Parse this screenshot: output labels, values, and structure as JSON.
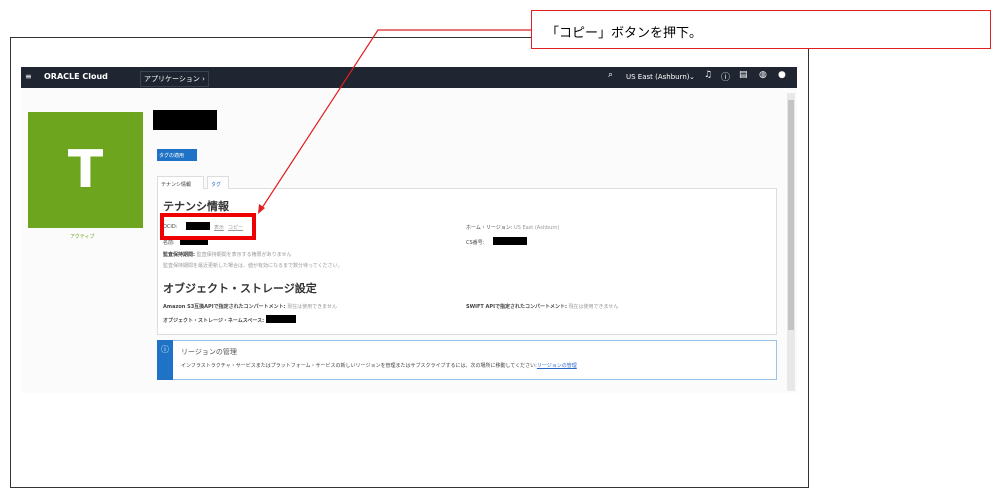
{
  "callout": "「コピー」ボタンを押下。",
  "nav": {
    "brand": "ORACLE Cloud",
    "apps": "アプリケーション ›",
    "region": "US East (Ashburn)",
    "icons": [
      "menu-icon",
      "search-icon",
      "chevron-down-icon",
      "bell-icon",
      "help-icon",
      "chat-icon",
      "globe-icon",
      "profile-icon"
    ]
  },
  "tenancy": {
    "initial": "T",
    "status": "アクティブ",
    "tag_button": "タグの適用"
  },
  "tabs": [
    "テナンシ情報",
    "タグ"
  ],
  "info": {
    "heading": "テナンシ情報",
    "ocid_label": "OCID:",
    "show": "表示",
    "copy": "コピー",
    "name_label": "名前:",
    "home_region_label": "ホーム・リージョン:",
    "home_region": "US East (Ashburn)",
    "cs_label": "CS番号:",
    "audit_label": "監査保持期間:",
    "audit_value": "監査保持期間を表示する権限がありません",
    "audit_note": "監査保持期間を最近更新した場合は、値が有効になるまで数分待ってください。"
  },
  "storage": {
    "heading": "オブジェクト・ストレージ設定",
    "s3_label": "Amazon S3互換APIで指定されたコンパートメント:",
    "s3_value": "現在は使用できません",
    "swift_label": "SWIFT APIで指定されたコンパートメント:",
    "swift_value": "現在は使用できません",
    "ns_label": "オブジェクト・ストレージ・ネームスペース:"
  },
  "region_box": {
    "title": "リージョンの管理",
    "text": "インフラストラクチャ・サービスまたはプラットフォーム・サービスの新しいリージョンを管理またはサブスクライブするには、次の場所に移動してください:",
    "link": "リージョンの管理"
  },
  "colors": {
    "accent": "#1f73c7",
    "green": "#6ea51f",
    "highlight": "#ee0000"
  }
}
